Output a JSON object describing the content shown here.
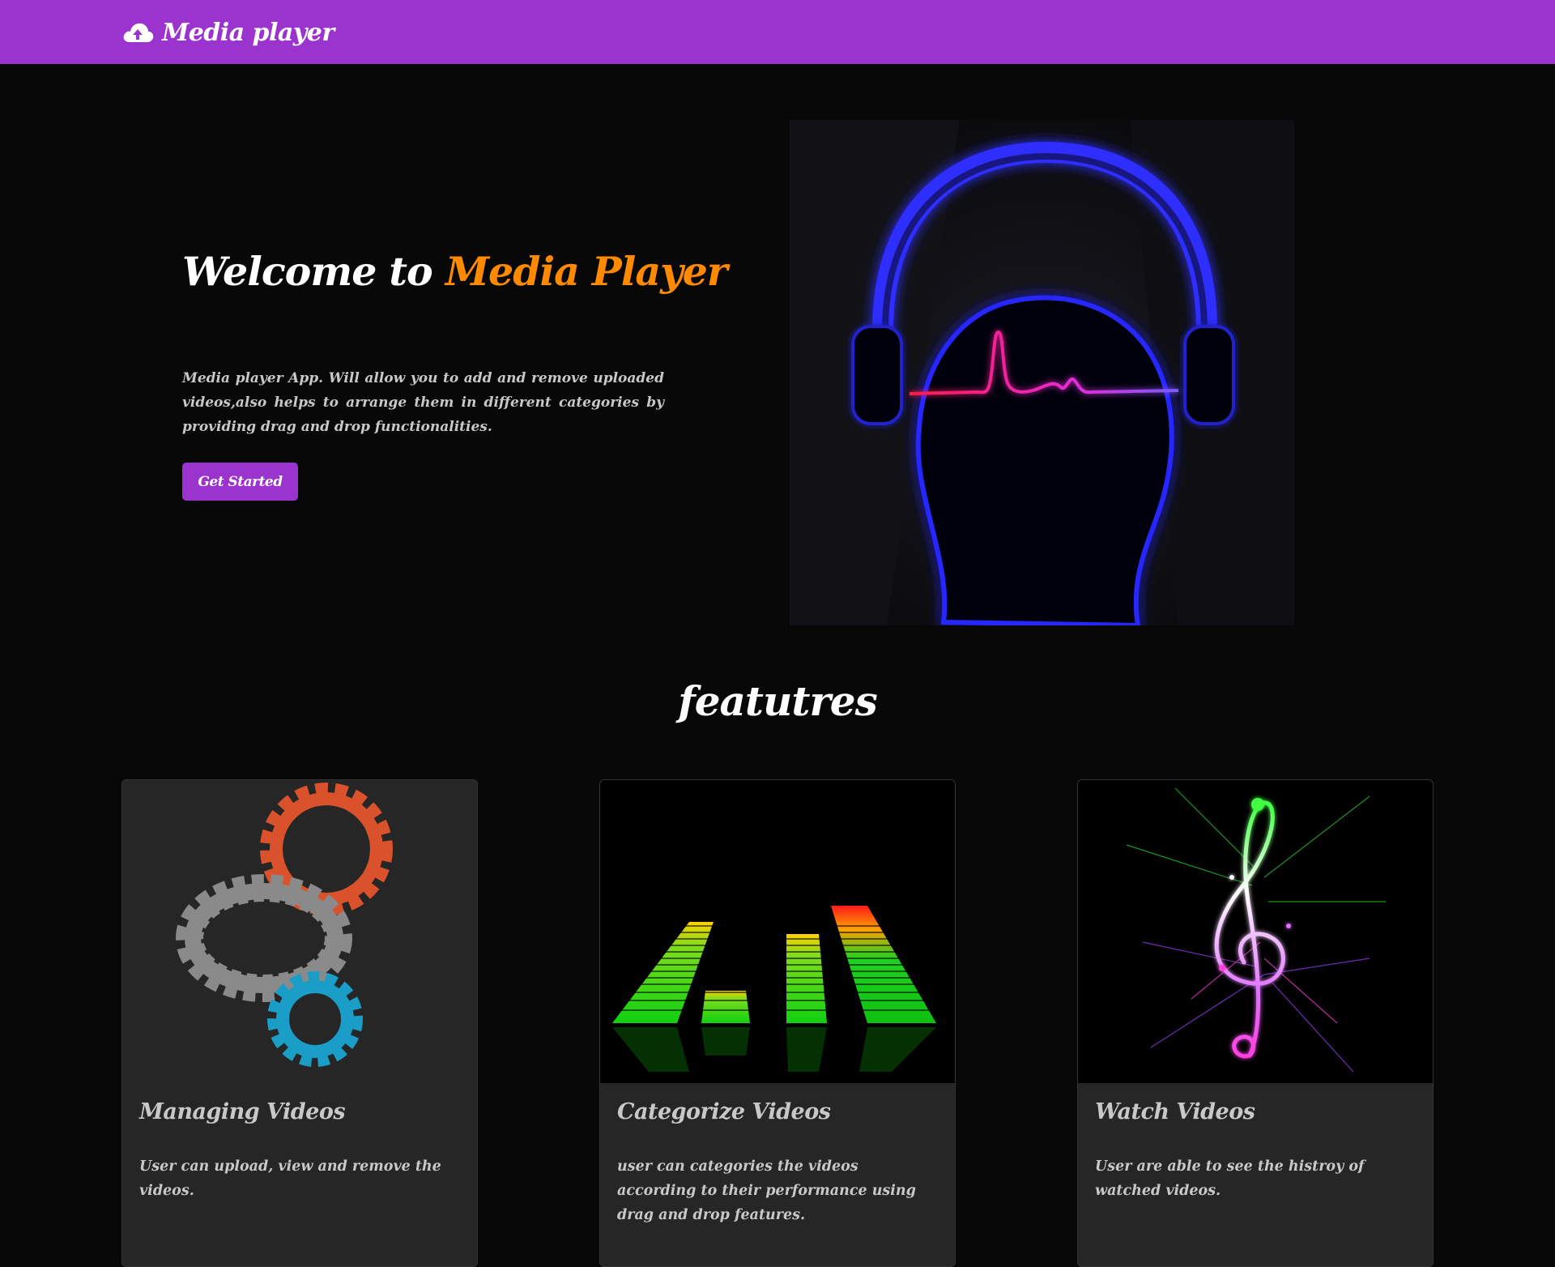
{
  "navbar": {
    "brand_icon": "cloud-upload-icon",
    "brand_text": "Media player",
    "background": "#9b34cf"
  },
  "hero": {
    "title_prefix": "Welcome to ",
    "title_accent": "Media Player",
    "accent_color": "#ff8a00",
    "description": "Media player App. Will allow you to add and remove uploaded videos,also helps to arrange them in different categories by providing drag and drop functionalities.",
    "button_label": "Get Started",
    "image": "headphones-heartbeat-image"
  },
  "features": {
    "title": "featutres",
    "cards": [
      {
        "image": "gears-image",
        "title": "Managing Videos",
        "text": "User can upload, view and remove the videos."
      },
      {
        "image": "audio-equalizer-image",
        "title": "Categorize Videos",
        "text": "user can categories the videos according to their performance using drag and drop features."
      },
      {
        "image": "treble-clef-image",
        "title": "Watch Videos",
        "text": "User are able to see the histroy of watched videos."
      }
    ]
  }
}
